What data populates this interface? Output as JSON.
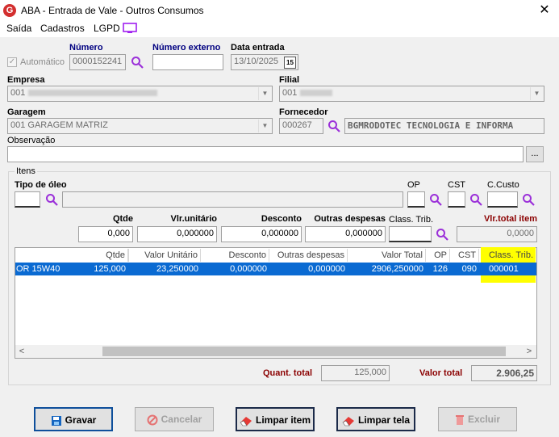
{
  "window": {
    "title": "ABA - Entrada de Vale - Outros Consumos",
    "close": "✕"
  },
  "menu": [
    "Saída",
    "Cadastros",
    "LGPD"
  ],
  "header": {
    "automatico_label": "Automático",
    "numero_label": "Número",
    "numero_value": "0000152241",
    "numero_externo_label": "Número externo",
    "numero_externo_value": "",
    "data_entrada_label": "Data entrada",
    "data_entrada_value": "13/10/2025",
    "calendar_glyph": "15",
    "empresa_label": "Empresa",
    "empresa_value": "001",
    "filial_label": "Filial",
    "filial_value": "001",
    "garagem_label": "Garagem",
    "garagem_value": "001 GARAGEM MATRIZ",
    "fornecedor_label": "Fornecedor",
    "fornecedor_code": "000267",
    "fornecedor_name": "BGMRODOTEC TECNOLOGIA E INFORMA",
    "observacao_label": "Observação",
    "observacao_value": "",
    "observacao_btn": "..."
  },
  "itens": {
    "group_label": "Itens",
    "tipo_oleo_label": "Tipo de óleo",
    "op_label": "OP",
    "cst_label": "CST",
    "ccusto_label": "C.Custo",
    "qtde_label": "Qtde",
    "qtde_value": "0,000",
    "vlr_unitario_label": "Vlr.unitário",
    "vlr_unitario_value": "0,000000",
    "desconto_label": "Desconto",
    "desconto_value": "0,000000",
    "outras_despesas_label": "Outras despesas",
    "outras_despesas_value": "0,000000",
    "class_trib_label": "Class. Trib.",
    "class_trib_value": "",
    "vlr_total_item_label": "Vlr.total item",
    "vlr_total_item_value": "0,0000"
  },
  "grid": {
    "columns": [
      "",
      "Qtde",
      "Valor Unitário",
      "Desconto",
      "Outras despesas",
      "Valor Total",
      "OP",
      "CST",
      "Class. Trib."
    ],
    "rows": [
      [
        "OR 15W40",
        "125,000",
        "23,250000",
        "0,000000",
        "0,000000",
        "2906,250000",
        "126",
        "090",
        "000001"
      ]
    ],
    "scroll_left": "<",
    "scroll_right": ">"
  },
  "totals": {
    "quant_total_label": "Quant. total",
    "quant_total_value": "125,000",
    "valor_total_label": "Valor total",
    "valor_total_value": "2.906,25"
  },
  "buttons": {
    "gravar": "Gravar",
    "cancelar": "Cancelar",
    "limpar_item": "Limpar item",
    "limpar_tela": "Limpar tela",
    "excluir": "Excluir"
  },
  "colors": {
    "accent": "#0a6ad2",
    "highlight": "#ffff00",
    "label_red": "#8b0000",
    "label_navy": "#000080"
  }
}
